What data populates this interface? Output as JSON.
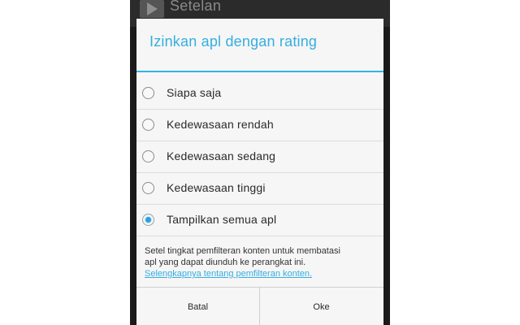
{
  "actionbar": {
    "title": "Setelan",
    "icon": "play-store-icon"
  },
  "dialog": {
    "title": "Izinkan apl dengan rating",
    "options": [
      {
        "label": "Siapa saja",
        "checked": false
      },
      {
        "label": "Kedewasaan rendah",
        "checked": false
      },
      {
        "label": "Kedewasaan sedang",
        "checked": false
      },
      {
        "label": "Kedewasaan tinggi",
        "checked": false
      },
      {
        "label": "Tampilkan semua apl",
        "checked": true
      }
    ],
    "message_line1": "Setel tingkat pemfilteran konten untuk membatasi",
    "message_line2": "apl yang dapat diunduh ke perangkat ini.",
    "link_text": "Selengkapnya tentang pemfilteran konten.",
    "cancel_label": "Batal",
    "ok_label": "Oke"
  },
  "colors": {
    "accent": "#33b5e5",
    "title_text": "#35aee0",
    "radio_selected": "#2f9fe0"
  }
}
